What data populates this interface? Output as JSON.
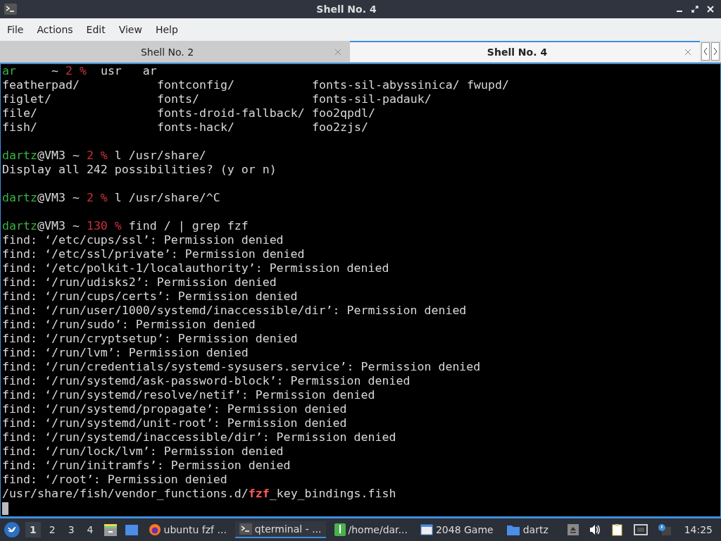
{
  "window": {
    "title": "Shell No. 4"
  },
  "menu": [
    "File",
    "Actions",
    "Edit",
    "View",
    "Help"
  ],
  "tabs": [
    {
      "label": "Shell No. 2",
      "selected": false
    },
    {
      "label": "Shell No. 4",
      "selected": true
    }
  ],
  "terminal": {
    "lines": [
      {
        "kind": "text",
        "segments": [
          {
            "text": "ar",
            "kind": "user"
          },
          {
            "text": "     ~ ",
            "kind": "plain"
          },
          {
            "text": "2 %",
            "kind": "code"
          },
          {
            "text": "  usr   ar",
            "kind": "plain"
          }
        ]
      },
      {
        "kind": "listing",
        "cells": [
          "featherpad/",
          "fontconfig/",
          "fonts-sil-abyssinica/",
          "fwupd/"
        ]
      },
      {
        "kind": "listing",
        "cells": [
          "figlet/",
          "fonts/",
          "fonts-sil-padauk/"
        ]
      },
      {
        "kind": "listing",
        "cells": [
          "file/",
          "fonts-droid-fallback/",
          "foo2qpdl/"
        ]
      },
      {
        "kind": "listing",
        "cells": [
          "fish/",
          "fonts-hack/",
          "foo2zjs/"
        ]
      },
      {
        "kind": "blank"
      },
      {
        "kind": "text",
        "segments": [
          {
            "text": "dartz",
            "kind": "user"
          },
          {
            "text": "@VM3 ~ ",
            "kind": "plain"
          },
          {
            "text": "2 %",
            "kind": "code"
          },
          {
            "text": " l /usr/share/",
            "kind": "plain"
          }
        ]
      },
      {
        "kind": "text",
        "segments": [
          {
            "text": "Display all 242 possibilities? (y or n)",
            "kind": "plain"
          }
        ]
      },
      {
        "kind": "blank"
      },
      {
        "kind": "text",
        "segments": [
          {
            "text": "dartz",
            "kind": "user"
          },
          {
            "text": "@VM3 ~ ",
            "kind": "plain"
          },
          {
            "text": "2 %",
            "kind": "code"
          },
          {
            "text": " l /usr/share/^C",
            "kind": "plain"
          }
        ]
      },
      {
        "kind": "blank"
      },
      {
        "kind": "text",
        "segments": [
          {
            "text": "dartz",
            "kind": "user"
          },
          {
            "text": "@VM3 ~ ",
            "kind": "plain"
          },
          {
            "text": "130 %",
            "kind": "code"
          },
          {
            "text": " find / | grep fzf",
            "kind": "plain"
          }
        ]
      },
      {
        "kind": "text",
        "segments": [
          {
            "text": "find: ‘/etc/cups/ssl’: Permission denied",
            "kind": "plain"
          }
        ]
      },
      {
        "kind": "text",
        "segments": [
          {
            "text": "find: ‘/etc/ssl/private’: Permission denied",
            "kind": "plain"
          }
        ]
      },
      {
        "kind": "text",
        "segments": [
          {
            "text": "find: ‘/etc/polkit-1/localauthority’: Permission denied",
            "kind": "plain"
          }
        ]
      },
      {
        "kind": "text",
        "segments": [
          {
            "text": "find: ‘/run/udisks2’: Permission denied",
            "kind": "plain"
          }
        ]
      },
      {
        "kind": "text",
        "segments": [
          {
            "text": "find: ‘/run/cups/certs’: Permission denied",
            "kind": "plain"
          }
        ]
      },
      {
        "kind": "text",
        "segments": [
          {
            "text": "find: ‘/run/user/1000/systemd/inaccessible/dir’: Permission denied",
            "kind": "plain"
          }
        ]
      },
      {
        "kind": "text",
        "segments": [
          {
            "text": "find: ‘/run/sudo’: Permission denied",
            "kind": "plain"
          }
        ]
      },
      {
        "kind": "text",
        "segments": [
          {
            "text": "find: ‘/run/cryptsetup’: Permission denied",
            "kind": "plain"
          }
        ]
      },
      {
        "kind": "text",
        "segments": [
          {
            "text": "find: ‘/run/lvm’: Permission denied",
            "kind": "plain"
          }
        ]
      },
      {
        "kind": "text",
        "segments": [
          {
            "text": "find: ‘/run/credentials/systemd-sysusers.service’: Permission denied",
            "kind": "plain"
          }
        ]
      },
      {
        "kind": "text",
        "segments": [
          {
            "text": "find: ‘/run/systemd/ask-password-block’: Permission denied",
            "kind": "plain"
          }
        ]
      },
      {
        "kind": "text",
        "segments": [
          {
            "text": "find: ‘/run/systemd/resolve/netif’: Permission denied",
            "kind": "plain"
          }
        ]
      },
      {
        "kind": "text",
        "segments": [
          {
            "text": "find: ‘/run/systemd/propagate’: Permission denied",
            "kind": "plain"
          }
        ]
      },
      {
        "kind": "text",
        "segments": [
          {
            "text": "find: ‘/run/systemd/unit-root’: Permission denied",
            "kind": "plain"
          }
        ]
      },
      {
        "kind": "text",
        "segments": [
          {
            "text": "find: ‘/run/systemd/inaccessible/dir’: Permission denied",
            "kind": "plain"
          }
        ]
      },
      {
        "kind": "text",
        "segments": [
          {
            "text": "find: ‘/run/lock/lvm’: Permission denied",
            "kind": "plain"
          }
        ]
      },
      {
        "kind": "text",
        "segments": [
          {
            "text": "find: ‘/run/initramfs’: Permission denied",
            "kind": "plain"
          }
        ]
      },
      {
        "kind": "text",
        "segments": [
          {
            "text": "find: ‘/root’: Permission denied",
            "kind": "plain"
          }
        ]
      },
      {
        "kind": "text",
        "segments": [
          {
            "text": "/usr/share/fish/vendor_functions.d/",
            "kind": "plain"
          },
          {
            "text": "fzf",
            "kind": "match"
          },
          {
            "text": "_key_bindings.fish",
            "kind": "plain"
          }
        ]
      },
      {
        "kind": "cursor"
      }
    ]
  },
  "taskbar": {
    "workspaces": [
      {
        "label": "1",
        "selected": true
      },
      {
        "label": "2",
        "selected": false
      },
      {
        "label": "3",
        "selected": false
      },
      {
        "label": "4",
        "selected": false
      }
    ],
    "tasks": [
      {
        "kind": "browser",
        "label": "ubuntu fzf ...",
        "selected": false
      },
      {
        "kind": "terminal",
        "label": "qterminal - ...",
        "selected": true
      },
      {
        "kind": "archive",
        "label": "/home/dar...",
        "selected": false
      },
      {
        "kind": "window",
        "label": "2048 Game",
        "selected": false
      },
      {
        "kind": "folder",
        "label": "dartz",
        "selected": false
      }
    ],
    "clock": "14:25"
  }
}
